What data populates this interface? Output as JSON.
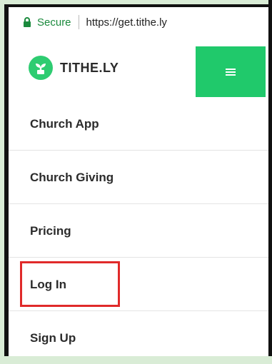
{
  "browser": {
    "secure_label": "Secure",
    "url": "https://get.tithe.ly"
  },
  "header": {
    "logo_text": "TITHE.LY",
    "menu_icon": "hamburger-icon",
    "accent_color": "#20c96b"
  },
  "nav": {
    "items": [
      {
        "label": "Church App"
      },
      {
        "label": "Church Giving"
      },
      {
        "label": "Pricing"
      },
      {
        "label": "Log In"
      },
      {
        "label": "Sign Up"
      }
    ]
  },
  "highlight": {
    "target": "Log In",
    "color": "#e02a2a"
  }
}
